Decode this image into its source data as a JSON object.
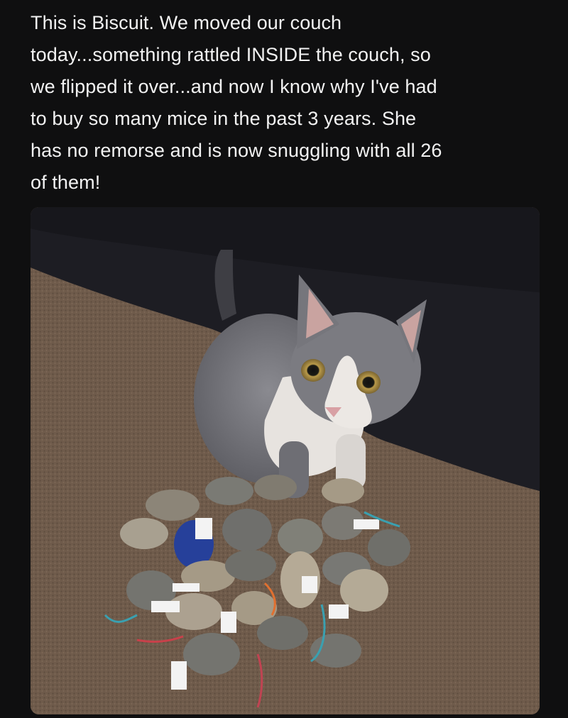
{
  "post": {
    "caption": "This is Biscuit. We moved our couch\ntoday...something rattled INSIDE the couch, so\nwe flipped it over...and now I know why I've had\nto buy so many mice in the past 3 years. She\nhas no remorse and is now snuggling with all 26\nof them!"
  },
  "photo": {
    "subject": "gray-and-white cat sitting behind a pile of toy mice on carpet",
    "colors": {
      "background": "#0f0f10",
      "text": "#f2f2f2",
      "couch": "#1c1c22",
      "carpet": "#6e5a4a",
      "cat_gray": "#7a7a80",
      "cat_white": "#e8e4e0"
    }
  }
}
